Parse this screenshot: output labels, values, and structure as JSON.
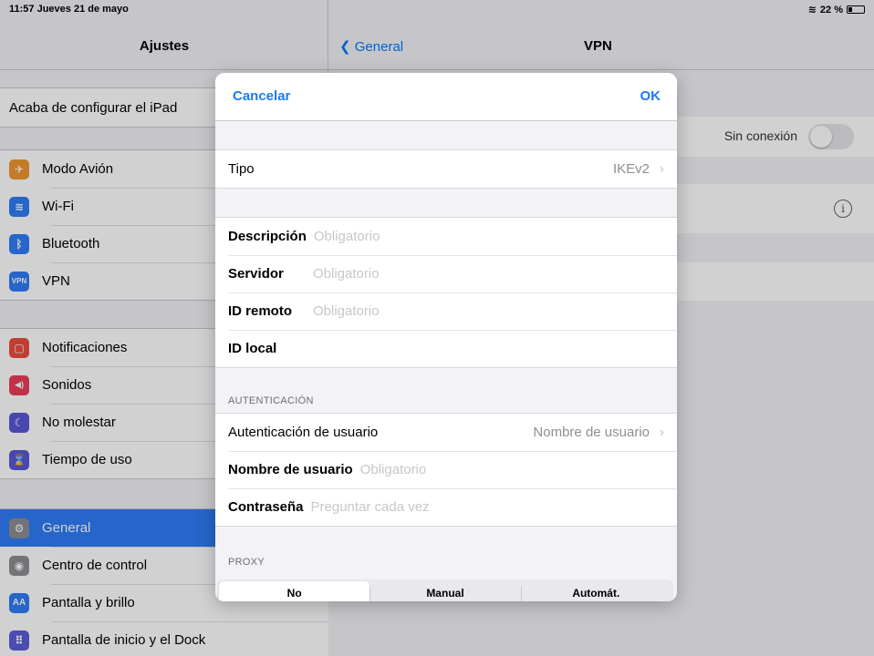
{
  "status": {
    "time_date": "11:57  Jueves 21 de mayo",
    "battery": "22 %"
  },
  "sidebar": {
    "title": "Ajustes",
    "setup": "Acaba de configurar el iPad",
    "group1": [
      {
        "label": "Modo Avión",
        "icon": "airplane-icon",
        "color": "#f0962f",
        "glyph": "✈"
      },
      {
        "label": "Wi-Fi",
        "icon": "wifi-icon",
        "color": "#2f7cf6",
        "glyph": "≋"
      },
      {
        "label": "Bluetooth",
        "icon": "bluetooth-icon",
        "color": "#2f7cf6",
        "glyph": "ᛒ"
      },
      {
        "label": "VPN",
        "icon": "vpn-icon",
        "color": "#2f7cf6",
        "glyph": "VPN"
      }
    ],
    "group2": [
      {
        "label": "Notificaciones",
        "icon": "notifications-icon",
        "color": "#eb4d3d",
        "glyph": "▢"
      },
      {
        "label": "Sonidos",
        "icon": "sounds-icon",
        "color": "#eb3d5b",
        "glyph": "◀)"
      },
      {
        "label": "No molestar",
        "icon": "moon-icon",
        "color": "#5856d6",
        "glyph": "☾"
      },
      {
        "label": "Tiempo de uso",
        "icon": "hourglass-icon",
        "color": "#5856d6",
        "glyph": "⌛"
      }
    ],
    "group3": [
      {
        "label": "General",
        "icon": "gear-icon",
        "color": "#8e8e93",
        "glyph": "⚙"
      },
      {
        "label": "Centro de control",
        "icon": "control-center-icon",
        "color": "#8e8e93",
        "glyph": "◉"
      },
      {
        "label": "Pantalla y brillo",
        "icon": "display-brightness-icon",
        "color": "#2f7cf6",
        "glyph": "AA"
      },
      {
        "label": "Pantalla de inicio y el Dock",
        "icon": "home-screen-icon",
        "color": "#5b5fd6",
        "glyph": "⠿"
      }
    ]
  },
  "detail": {
    "back": "General",
    "title": "VPN",
    "status": "Sin conexión"
  },
  "modal": {
    "cancel": "Cancelar",
    "ok": "OK",
    "tipo": {
      "label": "Tipo",
      "value": "IKEv2"
    },
    "fields": {
      "descripcion": {
        "label": "Descripción",
        "placeholder": "Obligatorio"
      },
      "servidor": {
        "label": "Servidor",
        "placeholder": "Obligatorio"
      },
      "id_remoto": {
        "label": "ID remoto",
        "placeholder": "Obligatorio"
      },
      "id_local": {
        "label": "ID local"
      }
    },
    "auth_section": "AUTENTICACIÓN",
    "auth": {
      "user_auth": {
        "label": "Autenticación de usuario",
        "value": "Nombre de usuario"
      },
      "username": {
        "label": "Nombre de usuario",
        "placeholder": "Obligatorio"
      },
      "password": {
        "label": "Contraseña",
        "placeholder": "Preguntar cada vez"
      }
    },
    "proxy_section": "PROXY",
    "proxy_options": [
      "No",
      "Manual",
      "Automát."
    ],
    "proxy_selected": "No"
  }
}
